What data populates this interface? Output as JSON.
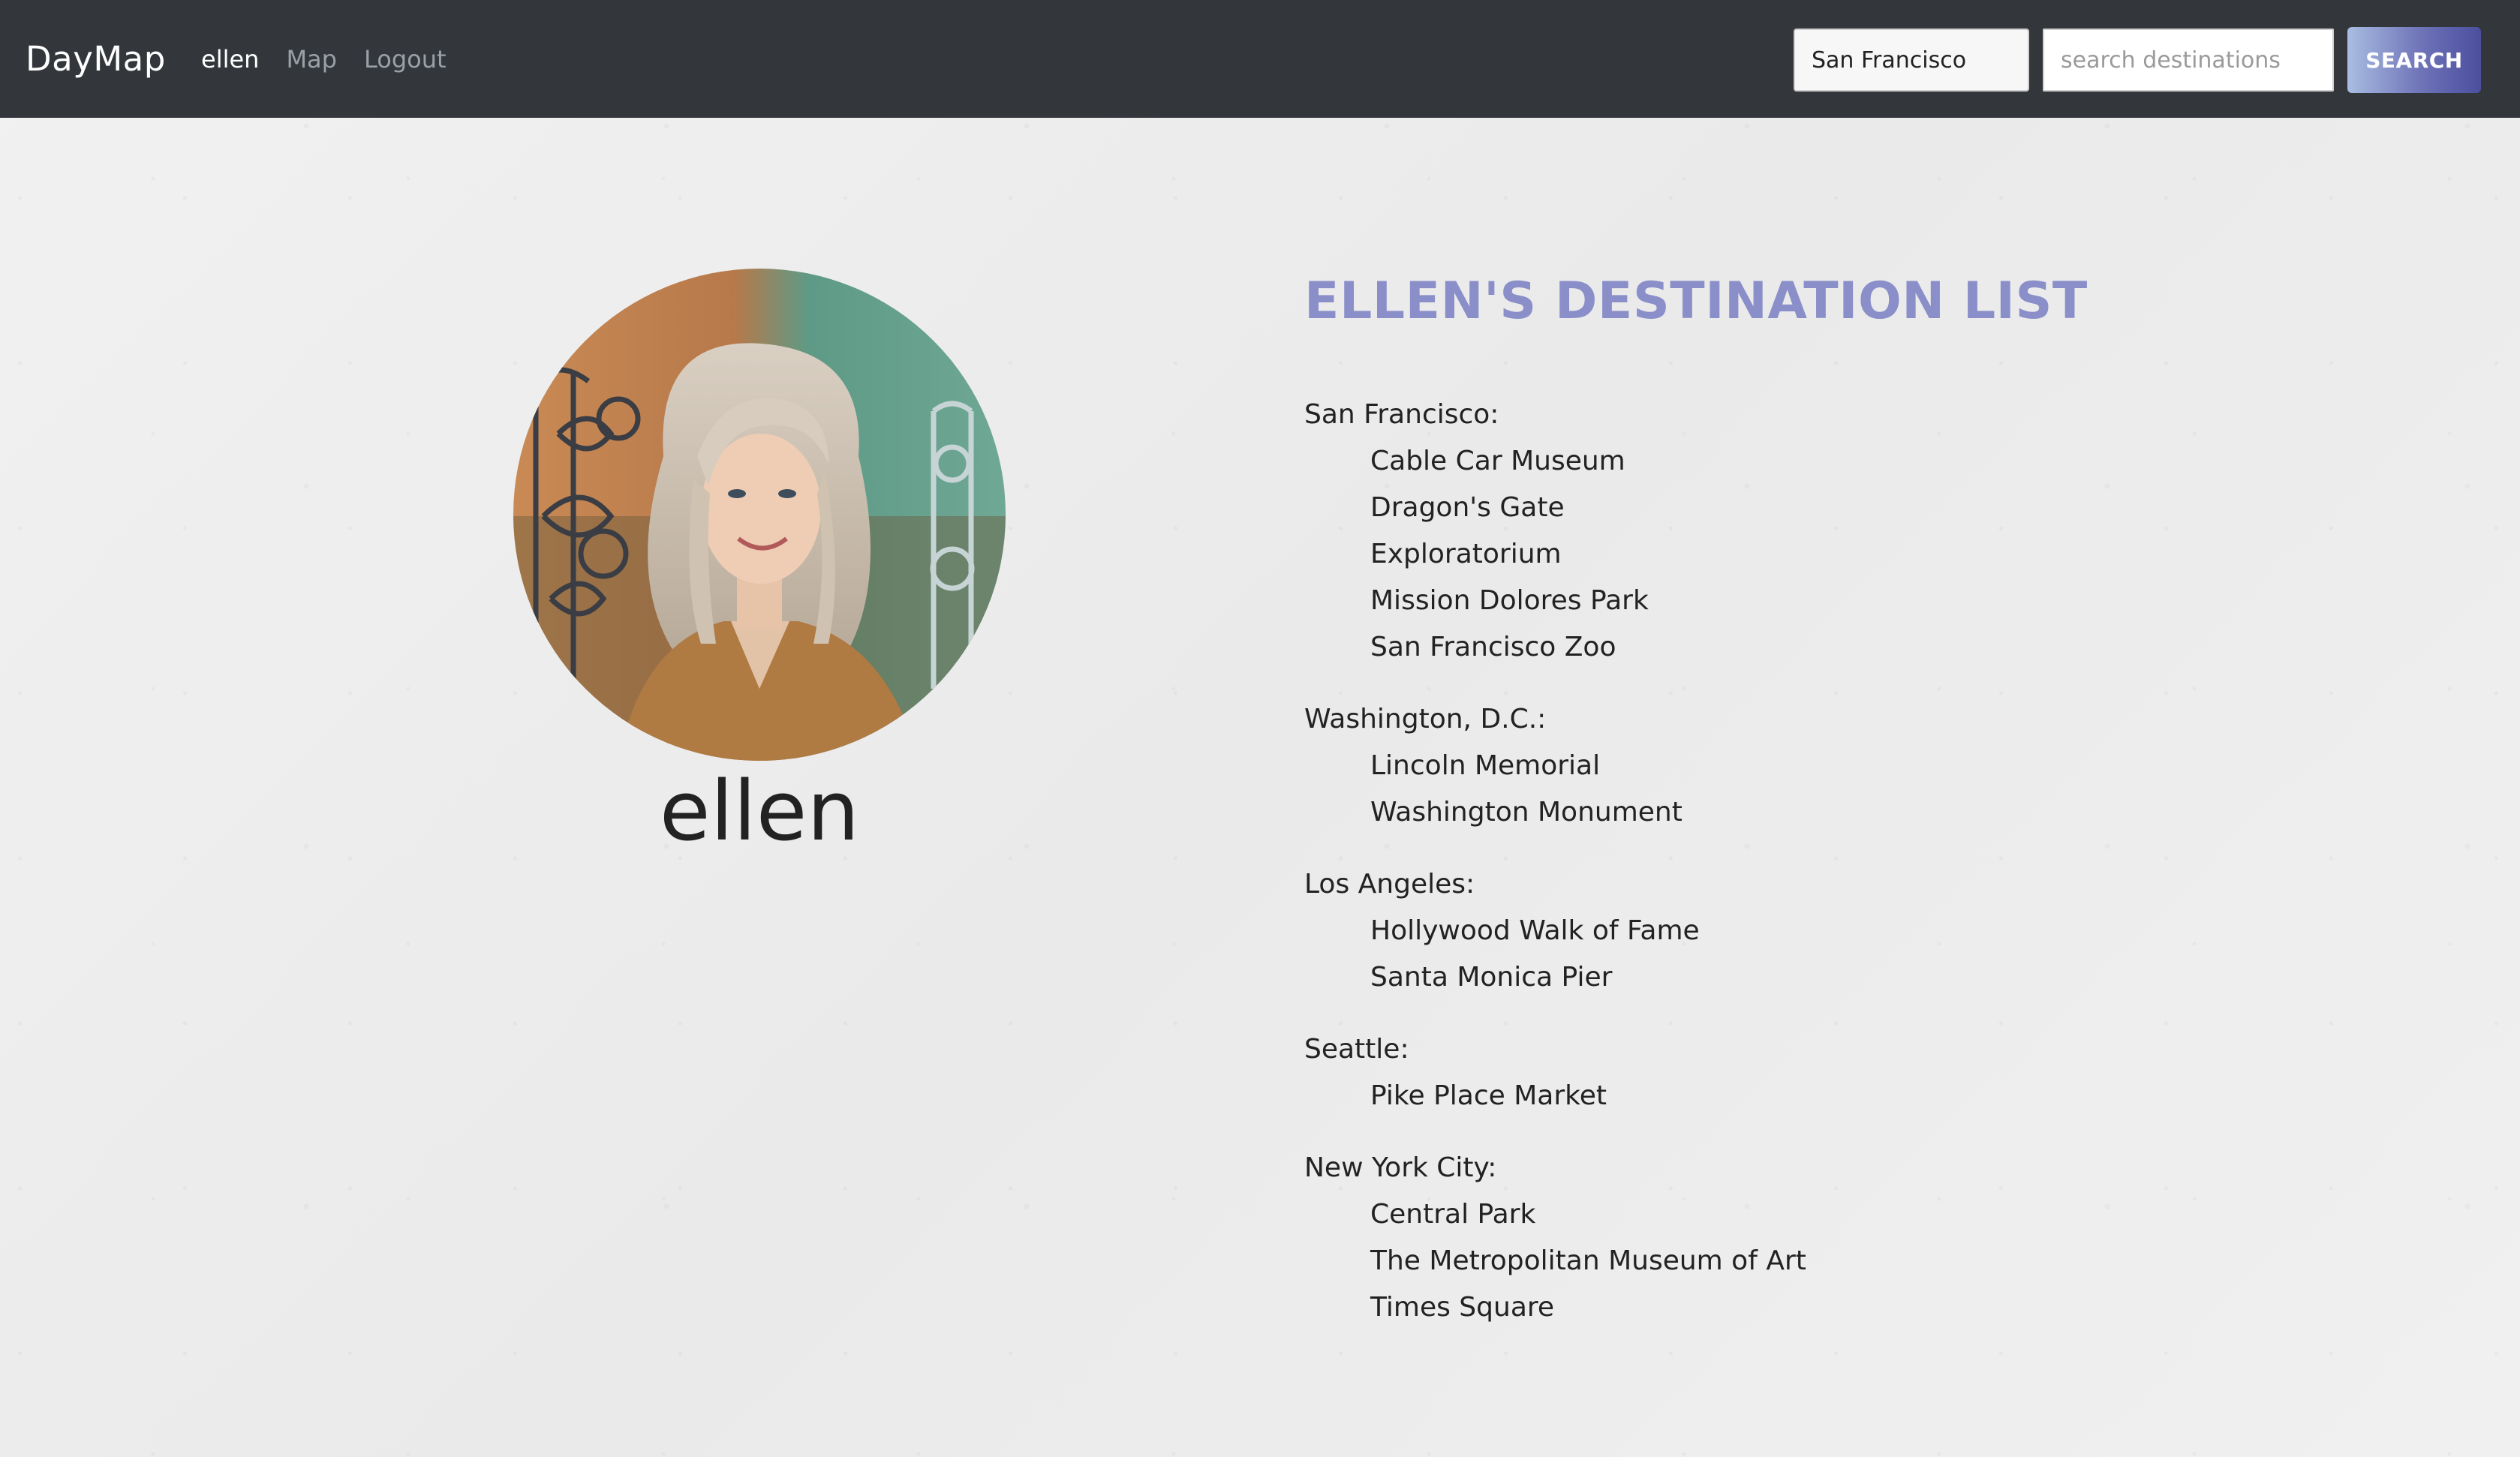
{
  "nav": {
    "brand": "DayMap",
    "links": [
      "ellen",
      "Map",
      "Logout"
    ],
    "city_value": "San Francisco",
    "search_placeholder": "search destinations",
    "search_label": "SEARCH"
  },
  "profile": {
    "username": "ellen"
  },
  "destinations": {
    "title": "ELLEN'S DESTINATION LIST",
    "groups": [
      {
        "city": "San Francisco:",
        "items": [
          "Cable Car Museum",
          "Dragon's Gate",
          "Exploratorium",
          "Mission Dolores Park",
          "San Francisco Zoo"
        ]
      },
      {
        "city": "Washington, D.C.:",
        "items": [
          "Lincoln Memorial",
          "Washington Monument"
        ]
      },
      {
        "city": "Los Angeles:",
        "items": [
          "Hollywood Walk of Fame",
          "Santa Monica Pier"
        ]
      },
      {
        "city": "Seattle:",
        "items": [
          "Pike Place Market"
        ]
      },
      {
        "city": "New York City:",
        "items": [
          "Central Park",
          "The Metropolitan Museum of Art",
          "Times Square"
        ]
      }
    ]
  },
  "colors": {
    "navbar": "#33373b",
    "title_accent": "#8a8fc9",
    "button_gradient_start": "#a9bde2",
    "button_gradient_end": "#4b4f9e"
  }
}
